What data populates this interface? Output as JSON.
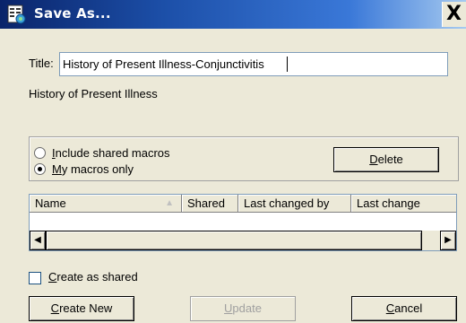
{
  "window": {
    "title": "Save As...",
    "close_label": "X"
  },
  "title_field": {
    "label": "Title:",
    "value": "History of Present Illness-Conjunctivitis"
  },
  "category": {
    "text": "History of Present Illness"
  },
  "options": [
    {
      "label": "Include shared macros",
      "accel": "I",
      "rest": "nclude shared macros",
      "selected": false
    },
    {
      "label": "My macros only",
      "accel": "M",
      "rest": "y macros only",
      "selected": true
    }
  ],
  "delete_button": {
    "label": "Delete",
    "accel": "D",
    "rest": "elete"
  },
  "list": {
    "columns": [
      "Name",
      "Shared",
      "Last changed by",
      "Last change"
    ],
    "rows": [],
    "scroll_left_icon": "◀",
    "scroll_right_icon": "▶",
    "sort_icon": "▲"
  },
  "create_shared": {
    "label": "Create as shared",
    "accel": "C",
    "rest": "reate as shared",
    "checked": false
  },
  "buttons": {
    "create_new": {
      "label": "Create New",
      "accel": "C",
      "rest": "reate New",
      "enabled": true
    },
    "update": {
      "label": "Update",
      "accel": "U",
      "rest": "pdate",
      "enabled": false
    },
    "cancel": {
      "label": "Cancel",
      "accel": "C",
      "rest": "ancel",
      "enabled": true
    }
  }
}
